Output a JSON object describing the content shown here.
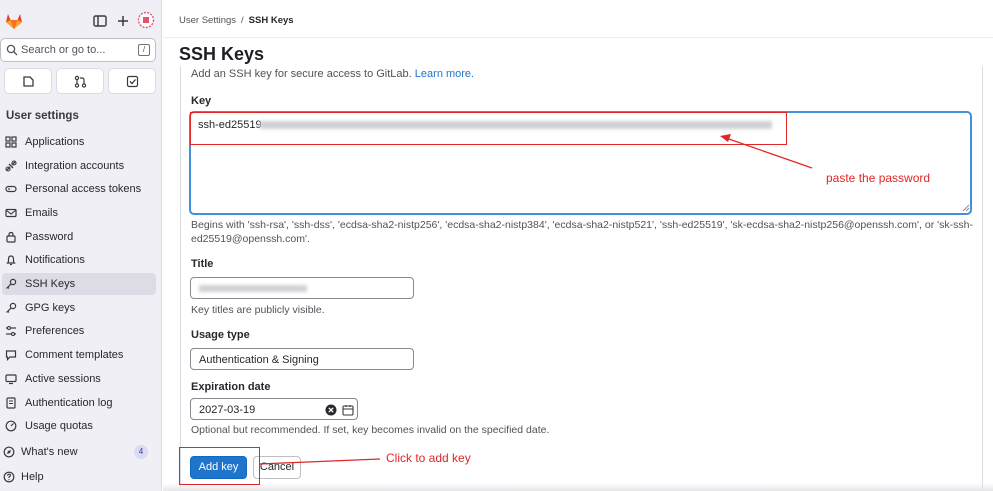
{
  "sidebar": {
    "search_placeholder": "Search or go to...",
    "search_shortcut": "/",
    "section_title": "User settings",
    "items": [
      {
        "label": "Applications",
        "icon": "applications-icon"
      },
      {
        "label": "Integration accounts",
        "icon": "integration-icon"
      },
      {
        "label": "Personal access tokens",
        "icon": "token-icon"
      },
      {
        "label": "Emails",
        "icon": "mail-icon"
      },
      {
        "label": "Password",
        "icon": "lock-icon"
      },
      {
        "label": "Notifications",
        "icon": "bell-icon"
      },
      {
        "label": "SSH Keys",
        "icon": "key-icon",
        "active": true
      },
      {
        "label": "GPG keys",
        "icon": "key-icon"
      },
      {
        "label": "Preferences",
        "icon": "preferences-icon"
      },
      {
        "label": "Comment templates",
        "icon": "comment-icon"
      },
      {
        "label": "Active sessions",
        "icon": "monitor-icon"
      },
      {
        "label": "Authentication log",
        "icon": "log-icon"
      },
      {
        "label": "Usage quotas",
        "icon": "gauge-icon"
      }
    ],
    "whats_new": {
      "label": "What's new",
      "count": "4"
    },
    "help_label": "Help"
  },
  "breadcrumb": {
    "parent": "User Settings",
    "separator": "/",
    "current": "SSH Keys"
  },
  "page_title": "SSH Keys",
  "intro": {
    "text": "Add an SSH key for secure access to GitLab.",
    "link": "Learn more."
  },
  "form": {
    "key": {
      "label": "Key",
      "value_prefix": "ssh-ed25519",
      "help": "Begins with 'ssh-rsa', 'ssh-dss', 'ecdsa-sha2-nistp256', 'ecdsa-sha2-nistp384', 'ecdsa-sha2-nistp521', 'ssh-ed25519', 'sk-ecdsa-sha2-nistp256@openssh.com', or 'sk-ssh-ed25519@openssh.com'."
    },
    "title": {
      "label": "Title",
      "help": "Key titles are publicly visible."
    },
    "usage_type": {
      "label": "Usage type",
      "value": "Authentication & Signing"
    },
    "expiration": {
      "label": "Expiration date",
      "value": "2027-03-19",
      "help": "Optional but recommended. If set, key becomes invalid on the specified date."
    },
    "submit_label": "Add key",
    "cancel_label": "Cancel"
  },
  "annotations": {
    "paste_note": "paste the password",
    "click_note": "Click to add key",
    "color": "#e02626"
  },
  "colors": {
    "primary": "#1f75cb",
    "sidebar_bg": "#f0eff5",
    "focus": "#428fdc"
  }
}
